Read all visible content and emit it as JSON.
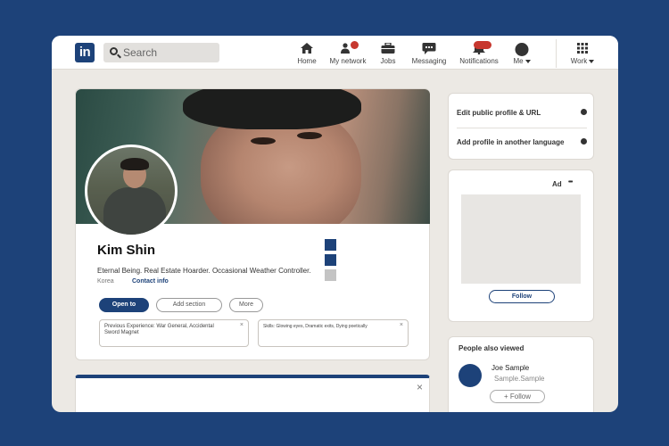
{
  "nav": {
    "logo": "in",
    "search_placeholder": "Search",
    "items": [
      {
        "label": "Home",
        "icon": "home-icon"
      },
      {
        "label": "My network",
        "icon": "network-icon"
      },
      {
        "label": "Jobs",
        "icon": "briefcase-icon"
      },
      {
        "label": "Messaging",
        "icon": "messaging-icon"
      },
      {
        "label": "Notifications",
        "icon": "bell-icon"
      },
      {
        "label": "Me",
        "icon": "avatar-icon"
      },
      {
        "label": "Work",
        "icon": "grid-icon"
      }
    ]
  },
  "profile": {
    "name": "Kim Shin",
    "headline": "Eternal Being. Real Estate Hoarder. Occasional Weather Controller.",
    "location": "Korea",
    "contact_info": "Contact info",
    "buttons": {
      "open_to": "Open to",
      "add_section": "Add section",
      "more": "More"
    },
    "cards": [
      {
        "text": "Previous Experience: War General, Accidental Sword Magnet"
      },
      {
        "text": "Skills: Glowing eyes, Dramatic exits, Dying poetically"
      }
    ]
  },
  "sidebar": {
    "links": [
      "Edit public profile & URL",
      "Add profile in another language"
    ],
    "ad": {
      "label": "Ad",
      "more": "•••",
      "follow": "Follow"
    },
    "people": {
      "title": "People also viewed",
      "items": [
        {
          "name": "Joe Sample",
          "subtitle": "Sample.Sample",
          "action": "+ Follow"
        }
      ]
    }
  },
  "colors": {
    "brand": "#1d4279",
    "notification": "#c7382f",
    "background": "#ece9e4"
  }
}
